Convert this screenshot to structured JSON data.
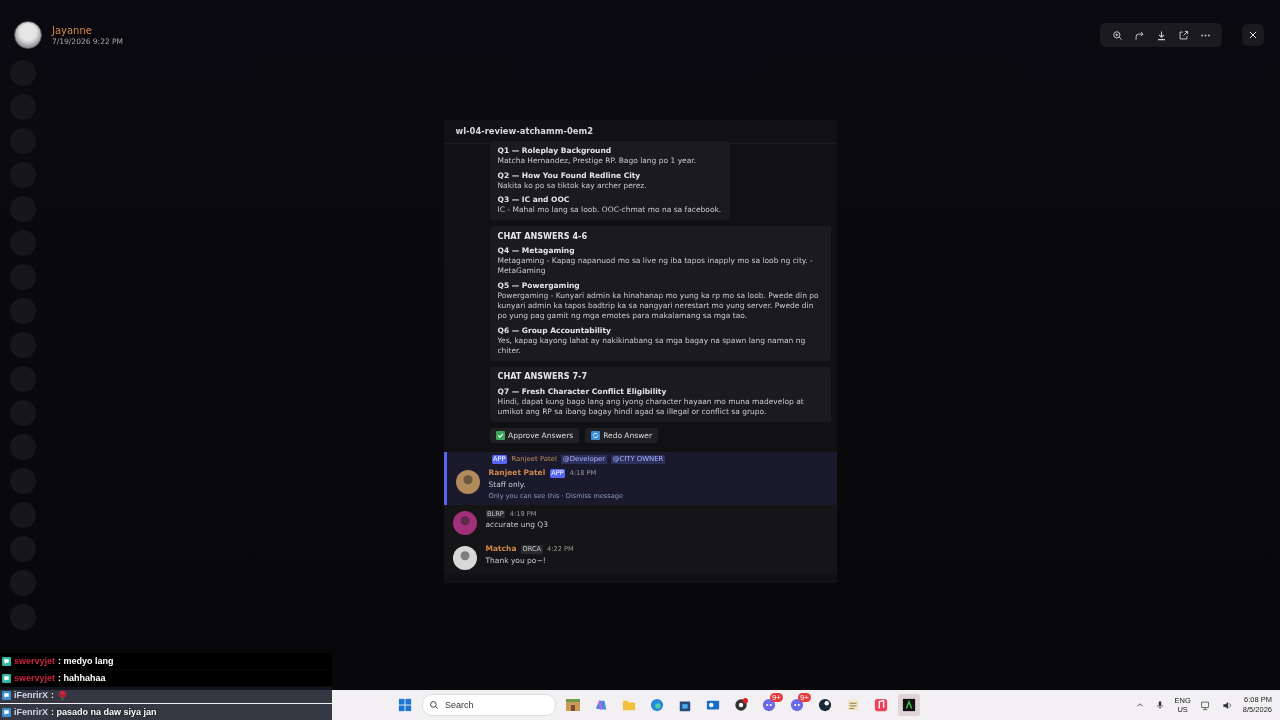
{
  "viewer": {
    "author": "Jayanne",
    "timestamp": "7/19/2026 9:22 PM"
  },
  "image": {
    "channel": "wl-04-review-atchamm-0em2",
    "embeds": [
      {
        "items": [
          {
            "q": "Q1 — Roleplay Background",
            "a": "Matcha Hernandez, Prestige RP. Bago lang po 1 year."
          },
          {
            "q": "Q2 — How You Found Redline City",
            "a": "Nakita ko po sa tiktok kay archer perez."
          },
          {
            "q": "Q3 — IC and OOC",
            "a": "IC - Mahal mo lang sa loob. OOC-chmat mo na sa facebook."
          }
        ]
      },
      {
        "title": "CHAT ANSWERS 4-6",
        "items": [
          {
            "q": "Q4 — Metagaming",
            "a": "Metagaming - Kapag napanuod mo sa live ng iba tapos inapply mo sa loob ng city. -MetaGaming"
          },
          {
            "q": "Q5 — Powergaming",
            "a": "Powergaming - Kunyari admin ka hinahanap mo yung ka rp mo sa loob. Pwede din po kunyari admin ka tapos badtrip ka sa nangyari nerestart mo yung server. Pwede din po yung pag gamit ng mga emotes para makalamang sa mga tao."
          },
          {
            "q": "Q6 — Group Accountability",
            "a": "Yes, kapag kayong lahat ay nakikinabang sa mga bagay na spawn lang naman ng chiter."
          }
        ]
      },
      {
        "title": "CHAT ANSWERS 7-7",
        "items": [
          {
            "q": "Q7 — Fresh Character Conflict Eligibility",
            "a": "Hindi, dapat kung bago lang ang iyong character hayaan mo muna madevelop at umikot ang RP sa ibang bagay hindi agad sa illegal or conflict sa grupo."
          }
        ]
      }
    ],
    "buttons": [
      "Approve Answers",
      "Redo Answer"
    ],
    "reply": {
      "badge": "APP",
      "name": "Ranjeet Patel",
      "mentions": [
        "@Developer",
        "@CITY OWNER"
      ]
    },
    "messages": [
      {
        "author": "Ranjeet Patel",
        "tag": "APP",
        "time": "4:18 PM",
        "text": "Staff only.",
        "note": "Only you can see this · Dismiss message",
        "highlighted": true
      },
      {
        "tag": "BLRP",
        "time": "4:19 PM",
        "text": "accurate ung Q3",
        "highlighted": false
      },
      {
        "author": "Matcha",
        "tag": "ORCA",
        "time": "4:22 PM",
        "text": "Thank you po~!",
        "highlighted": false
      }
    ]
  },
  "chat_overlay": [
    {
      "user": "swervyjet",
      "text": ": medyo lang",
      "color": "#c8243c",
      "emoji": false
    },
    {
      "user": "swervyjet",
      "text": ": hahhahaa",
      "color": "#c8243c",
      "emoji": false
    },
    {
      "user": "iFenrirX",
      "text": ": ",
      "color": "#cfd6e6",
      "emoji": true
    },
    {
      "user": "iFenrirX",
      "text": ": pasado na daw siya jan",
      "color": "#cfd6e6",
      "emoji": false
    }
  ],
  "taskbar": {
    "search_placeholder": "Search",
    "badges": [
      "9+",
      "9+"
    ],
    "language": "ENG",
    "region": "US",
    "time": "6:08 PM",
    "date": "8/5/2026"
  }
}
